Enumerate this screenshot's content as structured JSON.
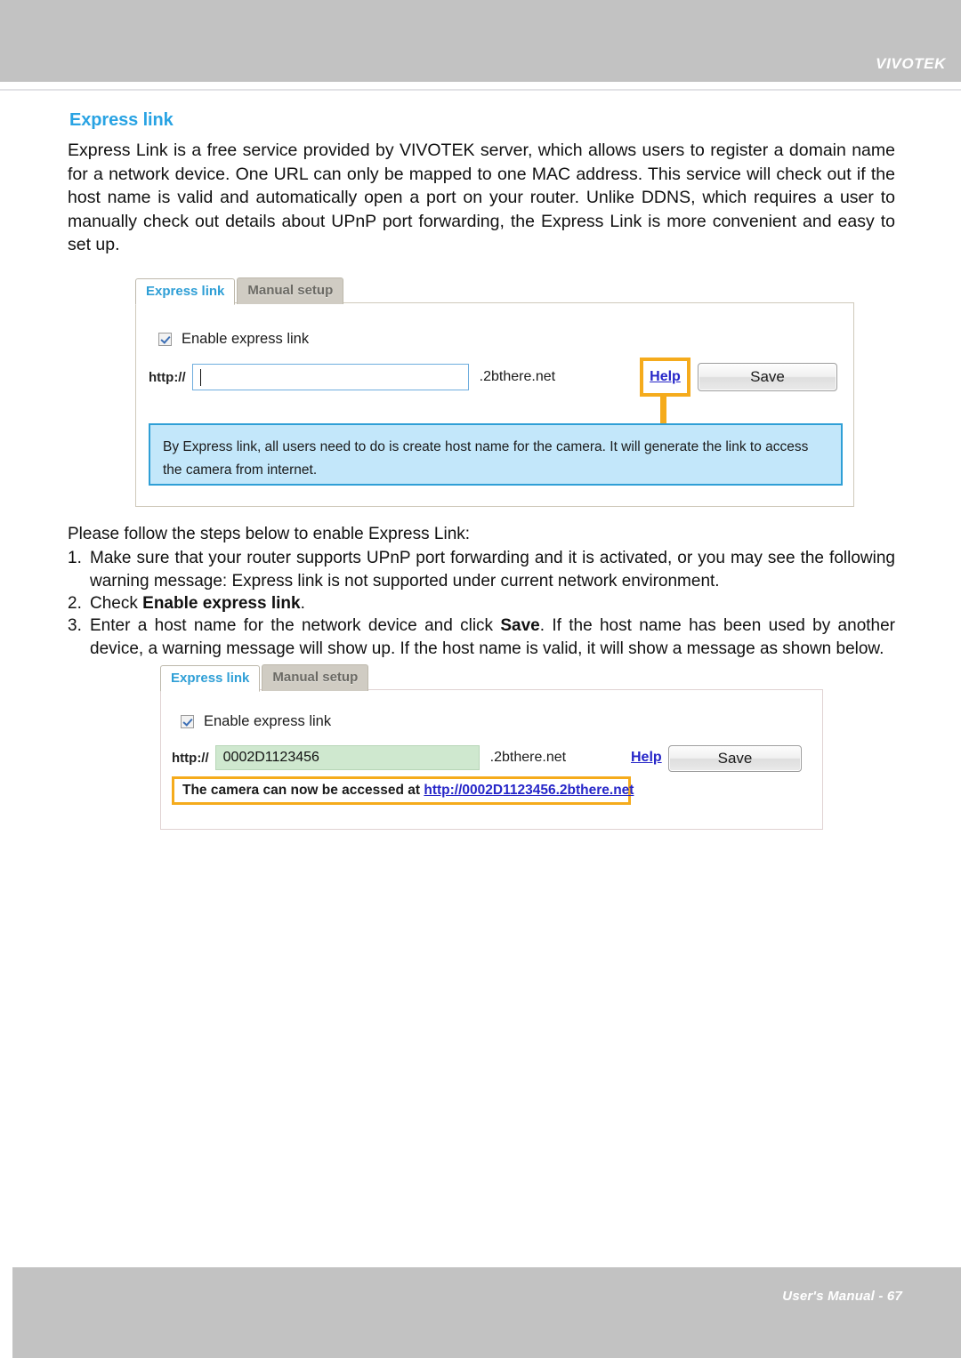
{
  "header": {
    "brand": "VIVOTEK"
  },
  "footer": {
    "label": "User's Manual - 67"
  },
  "page": {
    "section_title": "Express link",
    "intro": "Express Link is a free service provided by VIVOTEK server, which allows users to register a domain name for a network device. One URL can only be mapped to one MAC address. This service will check out if the host name is valid and automatically open a port on your router. Unlike DDNS, which requires a user to manually check out details about UPnP port forwarding, the Express Link is more convenient and easy to set up.",
    "steps_lead": "Please follow the steps below to enable Express Link:",
    "steps": [
      {
        "num": "1.",
        "text": "Make sure that your router supports UPnP port forwarding and it is activated, or you may see the following warning message: Express link is not supported under current network environment."
      },
      {
        "num": "2.",
        "prefix": "Check ",
        "bold": "Enable express link",
        "suffix": "."
      },
      {
        "num": "3.",
        "prefix": "Enter a host name for the network device and click ",
        "bold": "Save",
        "suffix": ". If the host name has been used by another device, a warning message will show up. If the host name is valid, it will show a message as shown below."
      }
    ]
  },
  "panel_empty": {
    "tabs": [
      {
        "label": "Express link",
        "active": true
      },
      {
        "label": "Manual setup",
        "active": false
      }
    ],
    "checkbox_label": "Enable express link",
    "protocol_label": "http://",
    "host_value": "",
    "host_placeholder": "",
    "domain_suffix": ".2bthere.net",
    "help_label": "Help",
    "save_label": "Save",
    "tooltip_text": "By Express link, all users need to do is create host name for the camera. It will generate the link to access the camera from internet."
  },
  "panel_filled": {
    "tabs": [
      {
        "label": "Express link",
        "active": true
      },
      {
        "label": "Manual setup",
        "active": false
      }
    ],
    "checkbox_label": "Enable express link",
    "protocol_label": "http://",
    "host_value": "0002D1123456",
    "domain_suffix": ".2bthere.net",
    "help_label": "Help",
    "save_label": "Save",
    "success_prefix": "The camera can now be accessed at ",
    "success_url": "http://0002D1123456.2bthere.net"
  },
  "colors": {
    "header_gray": "#c2c2c2",
    "accent_blue": "#29a3e3",
    "highlight_orange": "#f5ab1c",
    "tooltip_blue": "#c3e7fa",
    "tooltip_border": "#2f9fd6",
    "input_green": "#cfe8cf",
    "link_blue": "#2626c8"
  }
}
